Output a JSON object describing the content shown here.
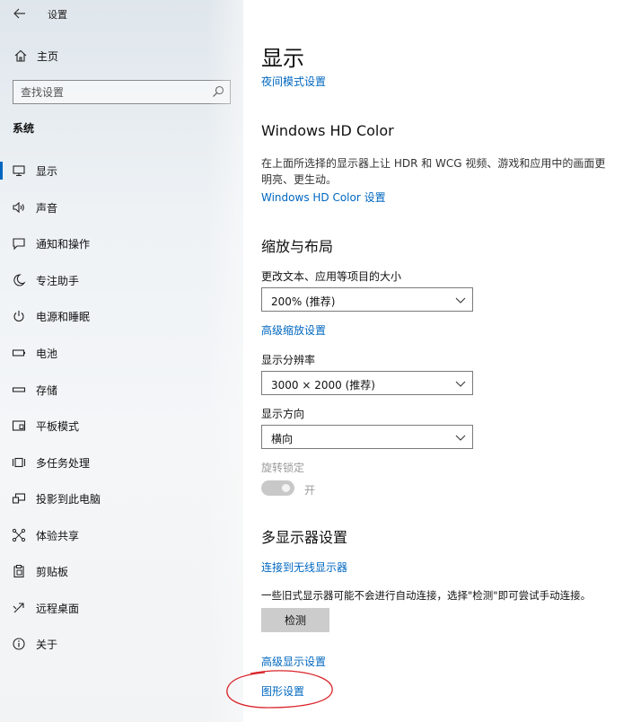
{
  "window": {
    "title": "设置"
  },
  "sidebar": {
    "home_label": "主页",
    "search_placeholder": "查找设置",
    "section_label": "系统",
    "items": [
      {
        "label": "显示",
        "icon": "monitor-icon",
        "active": true
      },
      {
        "label": "声音",
        "icon": "speaker-icon"
      },
      {
        "label": "通知和操作",
        "icon": "notification-icon"
      },
      {
        "label": "专注助手",
        "icon": "moon-icon"
      },
      {
        "label": "电源和睡眠",
        "icon": "power-icon"
      },
      {
        "label": "电池",
        "icon": "battery-icon"
      },
      {
        "label": "存储",
        "icon": "storage-icon"
      },
      {
        "label": "平板模式",
        "icon": "tablet-mode-icon"
      },
      {
        "label": "多任务处理",
        "icon": "multitasking-icon"
      },
      {
        "label": "投影到此电脑",
        "icon": "project-icon"
      },
      {
        "label": "体验共享",
        "icon": "shared-experience-icon"
      },
      {
        "label": "剪贴板",
        "icon": "clipboard-icon"
      },
      {
        "label": "远程桌面",
        "icon": "remote-desktop-icon"
      },
      {
        "label": "关于",
        "icon": "info-icon"
      }
    ]
  },
  "main": {
    "page_title": "显示",
    "night_light_link": "夜间模式设置",
    "hd_color": {
      "heading": "Windows HD Color",
      "description_line1": "在上面所选择的显示器上让 HDR 和 WCG 视频、游戏和应用中的画面更",
      "description_line2": "明亮、更生动。",
      "settings_link": "Windows HD Color 设置"
    },
    "scale_layout": {
      "heading": "缩放与布局",
      "scale_label": "更改文本、应用等项目的大小",
      "scale_value": "200% (推荐)",
      "advanced_scaling_link": "高级缩放设置",
      "resolution_label": "显示分辨率",
      "resolution_value": "3000 × 2000 (推荐)",
      "orientation_label": "显示方向",
      "orientation_value": "横向",
      "rotation_lock_label": "旋转锁定",
      "rotation_lock_state": "开"
    },
    "multi_display": {
      "heading": "多显示器设置",
      "connect_wireless_link": "连接到无线显示器",
      "description": "一些旧式显示器可能不会进行自动连接，选择\"检测\"即可尝试手动连接。",
      "detect_button": "检测",
      "advanced_display_link": "高级显示设置",
      "graphics_settings_link": "图形设置"
    }
  },
  "colors": {
    "accent": "#0067c0",
    "highlight_ellipse": "#d9262c"
  }
}
